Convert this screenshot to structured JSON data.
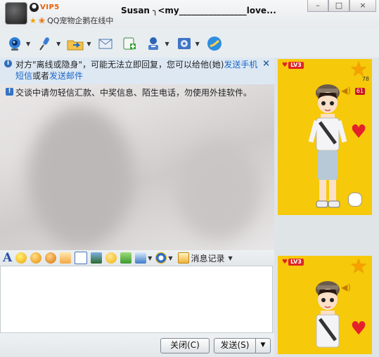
{
  "title_bar": {
    "vip_badge": "VIP5",
    "status_text": "QQ宠物企鹅在线中",
    "contact_name": "Susan ╮<my________________love...",
    "window_buttons": [
      "–",
      "□",
      "×"
    ]
  },
  "toolbar": {
    "items": [
      {
        "icon": "webcam-icon",
        "has_menu": true
      },
      {
        "icon": "microphone-icon",
        "has_menu": true
      },
      {
        "icon": "folder-transfer-icon",
        "has_menu": true
      },
      {
        "icon": "mail-icon",
        "has_menu": false
      },
      {
        "icon": "sms-icon",
        "has_menu": false
      },
      {
        "icon": "remote-assist-icon",
        "has_menu": true
      },
      {
        "icon": "app-settings-icon",
        "has_menu": true
      },
      {
        "icon": "qzone-icon",
        "has_menu": false
      }
    ]
  },
  "notices": {
    "offline": {
      "text_before": "对方\"离线或隐身\"，可能无法立即回复，您可以给他(她)",
      "link1": "发送手机短信",
      "text_mid": "或者",
      "link2": "发送邮件",
      "close": "×"
    },
    "security": {
      "text": "交谈中请勿轻信汇款、中奖信息、陌生电话，勿使用外挂软件。"
    }
  },
  "format_bar": {
    "font_glyph": "A",
    "message_record_label": "消息记录"
  },
  "bottom_bar": {
    "close_label": "关闭(C)",
    "send_label": "发送(S)",
    "send_menu_glyph": "▼"
  },
  "show_panel": {
    "level_top": "LV3",
    "level_bottom": "LV3",
    "star_count": "78",
    "volume_badge": "61"
  },
  "colors": {
    "accent": "#1b66c8",
    "notice_bg": "#dde8f3",
    "show_bg": "#f6c90a",
    "heart": "#e4202b"
  }
}
